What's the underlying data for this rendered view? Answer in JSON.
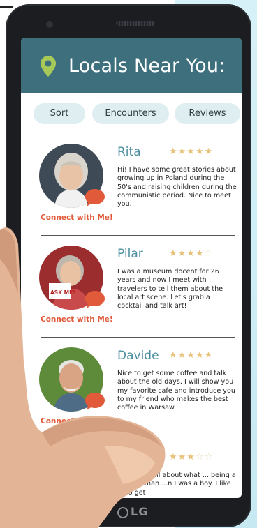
{
  "header": {
    "title": "Locals Near You:"
  },
  "tabs": [
    {
      "label": "Sort"
    },
    {
      "label": "Encounters"
    },
    {
      "label": "Reviews"
    }
  ],
  "colors": {
    "header": "#3d6f7d",
    "accent": "#e15b3b",
    "name": "#4d8fa0",
    "pin": "#a7c957",
    "tab_bg": "#dfeef0"
  },
  "locals": [
    {
      "name": "Rita",
      "rating": 5,
      "bio": "Hi! I have some great stories about growing up in Poland during the 50's and raising children during the communistic period. Nice to meet you.",
      "connect_label": "Connect with Me!"
    },
    {
      "name": "Pilar",
      "rating": 4,
      "bio": "I was a museum docent for 26 years and now I meet with travelers to tell them about the local art scene. Let's grab a cocktail and talk art!",
      "connect_label": "Connect with Me!",
      "sign_text": "ASK ME!"
    },
    {
      "name": "Davide",
      "rating": 5,
      "bio": "Nice to get some coffee and talk about the old days. I will show you my favorite cafe and introduce you to my friend who makes the best coffee in Warsaw.",
      "connect_label": "Connect with Me!"
    },
    {
      "rating": 3,
      "bio_partial": "...ll you all about what ... being a fisherman ...n I was a boy. I like to get"
    }
  ],
  "device": {
    "brand": "LG"
  },
  "icons": {
    "pin": "location-pin-icon",
    "bubble": "chat-bubble-icon",
    "star": "star-icon"
  }
}
